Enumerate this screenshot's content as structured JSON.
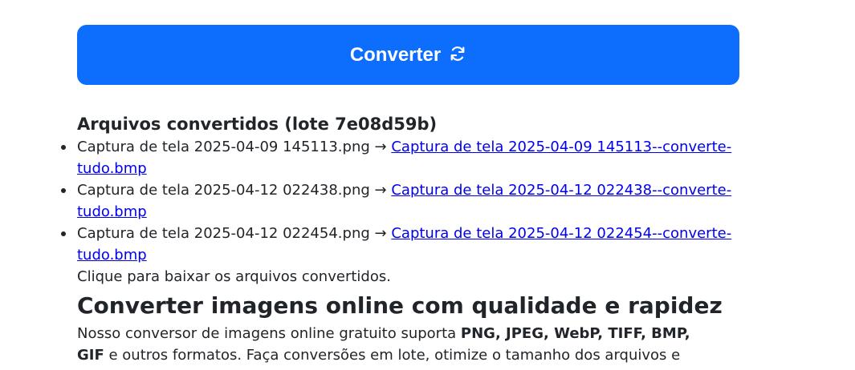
{
  "convert_button": {
    "label": "Converter",
    "icon": "refresh-icon",
    "color": "#0d6efd"
  },
  "results": {
    "title": "Arquivos convertidos (lote 7e08d59b)",
    "files": [
      {
        "source": "Captura de tela 2025-04-09 145113.png",
        "arrow": "→",
        "output": "Captura de tela 2025-04-09 145113--converte-tudo.bmp"
      },
      {
        "source": "Captura de tela 2025-04-12 022438.png",
        "arrow": "→",
        "output": "Captura de tela 2025-04-12 022438--converte-tudo.bmp"
      },
      {
        "source": "Captura de tela 2025-04-12 022454.png",
        "arrow": "→",
        "output": "Captura de tela 2025-04-12 022454--converte-tudo.bmp"
      }
    ],
    "hint": "Clique para baixar os arquivos convertidos."
  },
  "info": {
    "title": "Converter imagens online com qualidade e rapidez",
    "text_before": "Nosso conversor de imagens online gratuito suporta ",
    "formats": "PNG, JPEG, WebP, TIFF, BMP, GIF",
    "text_after": " e outros formatos. Faça conversões em lote, otimize o tamanho dos arquivos e preserve a nitidez mesmo depois de muitas conversões e compressões."
  }
}
